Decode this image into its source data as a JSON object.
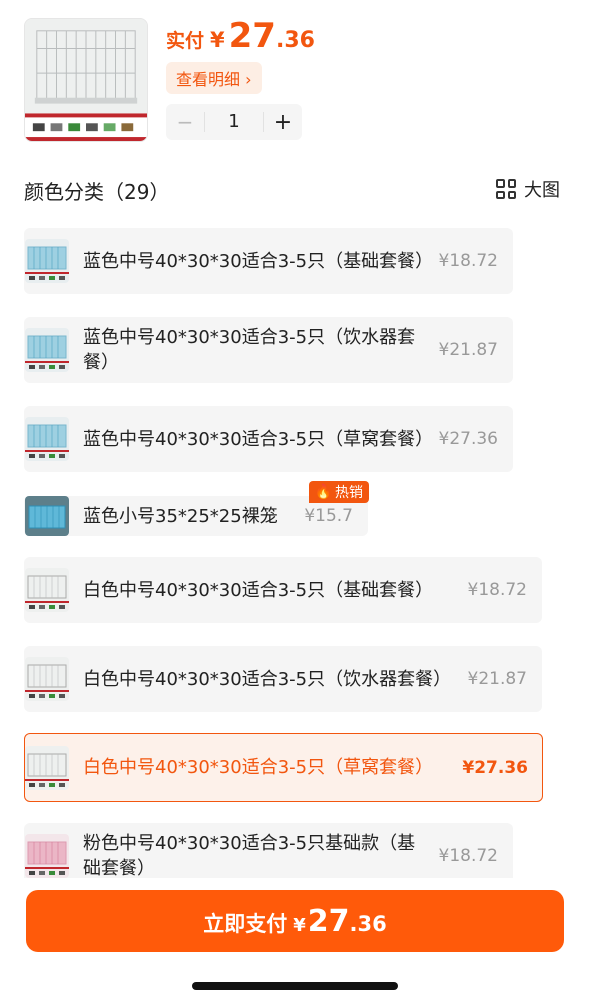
{
  "header": {
    "price_prefix": "实付",
    "currency": "¥",
    "price_int": "27",
    "price_dec": ".36",
    "detail_label": "查看明细 ›",
    "quantity": "1",
    "minus_label": "−",
    "plus_label": "+"
  },
  "section": {
    "title": "颜色分类（29）",
    "bigview_label": "大图"
  },
  "skus": [
    {
      "name": "蓝色中号40*30*30适合3-5只（基础套餐）",
      "price": "¥18.72",
      "color": "blue"
    },
    {
      "name": "蓝色中号40*30*30适合3-5只（饮水器套餐）",
      "price": "¥21.87",
      "color": "blue"
    },
    {
      "name": "蓝色中号40*30*30适合3-5只（草窝套餐）",
      "price": "¥27.36",
      "color": "blue"
    },
    {
      "name": "蓝色小号35*25*25裸笼",
      "price": "¥15.7",
      "color": "blue-small",
      "badge": "热销"
    },
    {
      "name": "白色中号40*30*30适合3-5只（基础套餐）",
      "price": "¥18.72",
      "color": "white"
    },
    {
      "name": "白色中号40*30*30适合3-5只（饮水器套餐）",
      "price": "¥21.87",
      "color": "white"
    },
    {
      "name": "白色中号40*30*30适合3-5只（草窝套餐）",
      "price": "¥27.36",
      "color": "white",
      "selected": true
    },
    {
      "name": "粉色中号40*30*30适合3-5只基础款（基础套餐）",
      "price": "¥18.72",
      "color": "pink"
    }
  ],
  "footer": {
    "pay_label": "立即支付",
    "currency": "¥",
    "price_int": "27",
    "price_dec": ".36"
  },
  "colors": {
    "accent": "#f2560f",
    "button": "#ff5a0a"
  }
}
